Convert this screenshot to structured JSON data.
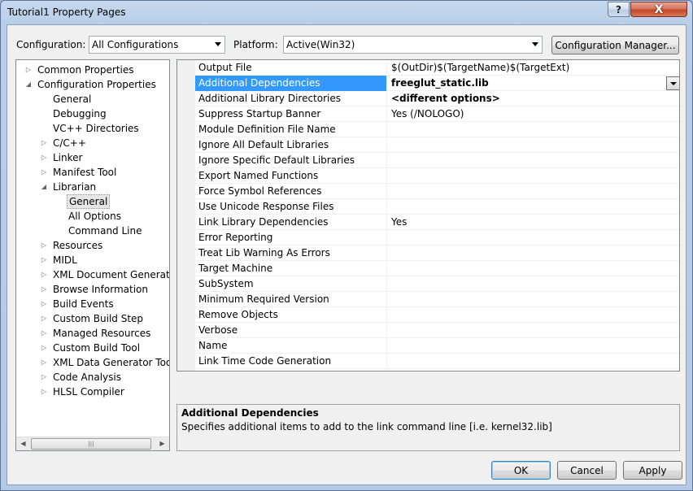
{
  "window": {
    "title": "Tutorial1 Property Pages",
    "help_label": "?",
    "close_label": "X"
  },
  "toolbar": {
    "configuration_label": "Configuration:",
    "configuration_value": "All Configurations",
    "platform_label": "Platform:",
    "platform_value": "Active(Win32)",
    "config_manager_label": "Configuration Manager..."
  },
  "tree": {
    "items": [
      {
        "label": "Common Properties",
        "twisty": "▷"
      },
      {
        "label": "Configuration Properties",
        "twisty": "◢"
      },
      {
        "label": "General",
        "twisty": ""
      },
      {
        "label": "Debugging",
        "twisty": ""
      },
      {
        "label": "VC++ Directories",
        "twisty": ""
      },
      {
        "label": "C/C++",
        "twisty": "▷"
      },
      {
        "label": "Linker",
        "twisty": "▷"
      },
      {
        "label": "Manifest Tool",
        "twisty": "▷"
      },
      {
        "label": "Librarian",
        "twisty": "◢"
      },
      {
        "label": "General",
        "twisty": ""
      },
      {
        "label": "All Options",
        "twisty": ""
      },
      {
        "label": "Command Line",
        "twisty": ""
      },
      {
        "label": "Resources",
        "twisty": "▷"
      },
      {
        "label": "MIDL",
        "twisty": "▷"
      },
      {
        "label": "XML Document Generator",
        "twisty": "▷"
      },
      {
        "label": "Browse Information",
        "twisty": "▷"
      },
      {
        "label": "Build Events",
        "twisty": "▷"
      },
      {
        "label": "Custom Build Step",
        "twisty": "▷"
      },
      {
        "label": "Managed Resources",
        "twisty": "▷"
      },
      {
        "label": "Custom Build Tool",
        "twisty": "▷"
      },
      {
        "label": "XML Data Generator Tool",
        "twisty": "▷"
      },
      {
        "label": "Code Analysis",
        "twisty": "▷"
      },
      {
        "label": "HLSL Compiler",
        "twisty": "▷"
      }
    ],
    "selected": "General (Librarian)"
  },
  "properties": {
    "rows": [
      {
        "name": "Output File",
        "value": "$(OutDir)$(TargetName)$(TargetExt)"
      },
      {
        "name": "Additional Dependencies",
        "value": "freeglut_static.lib"
      },
      {
        "name": "Additional Library Directories",
        "value": "<different options>"
      },
      {
        "name": "Suppress Startup Banner",
        "value": "Yes (/NOLOGO)"
      },
      {
        "name": "Module Definition File Name",
        "value": ""
      },
      {
        "name": "Ignore All Default Libraries",
        "value": ""
      },
      {
        "name": "Ignore Specific Default Libraries",
        "value": ""
      },
      {
        "name": "Export Named Functions",
        "value": ""
      },
      {
        "name": "Force Symbol References",
        "value": ""
      },
      {
        "name": "Use Unicode Response Files",
        "value": ""
      },
      {
        "name": "Link Library Dependencies",
        "value": "Yes"
      },
      {
        "name": "Error Reporting",
        "value": ""
      },
      {
        "name": "Treat Lib Warning As Errors",
        "value": ""
      },
      {
        "name": "Target Machine",
        "value": ""
      },
      {
        "name": "SubSystem",
        "value": ""
      },
      {
        "name": "Minimum Required Version",
        "value": ""
      },
      {
        "name": "Remove Objects",
        "value": ""
      },
      {
        "name": "Verbose",
        "value": ""
      },
      {
        "name": "Name",
        "value": ""
      },
      {
        "name": "Link Time Code Generation",
        "value": ""
      }
    ]
  },
  "description": {
    "title": "Additional Dependencies",
    "text": "Specifies additional items to add to the link command line [i.e. kernel32.lib]"
  },
  "buttons": {
    "ok": "OK",
    "cancel": "Cancel",
    "apply": "Apply"
  },
  "colors": {
    "selection": "#3399ff",
    "window_frame": "#b7cde8",
    "client_bg": "#f0f0f0"
  }
}
